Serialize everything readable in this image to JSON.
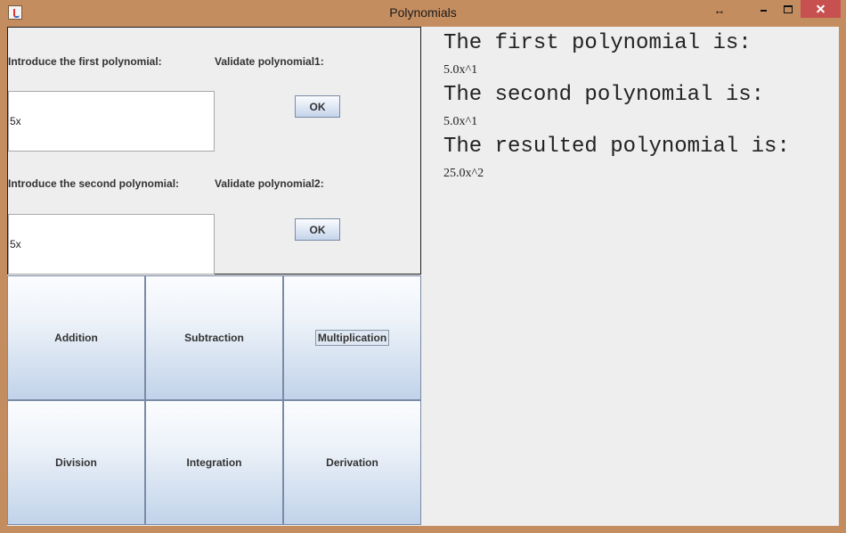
{
  "window": {
    "title": "Polynomials"
  },
  "input_panel": {
    "first_label": "Introduce the first polynomial:",
    "first_value": "5x",
    "validate1_label": "Validate polynomial1:",
    "ok1_label": "OK",
    "second_label": "Introduce the second polynomial:",
    "second_value": "5x",
    "validate2_label": "Validate polynomial2:",
    "ok2_label": "OK"
  },
  "operations": [
    {
      "label": "Addition"
    },
    {
      "label": "Subtraction"
    },
    {
      "label": "Multiplication",
      "focused": true
    },
    {
      "label": "Division"
    },
    {
      "label": "Integration"
    },
    {
      "label": "Derivation"
    }
  ],
  "output": {
    "first_heading": "The first polynomial is:",
    "first_value": "5.0x^1",
    "second_heading": "The second polynomial is:",
    "second_value": "5.0x^1",
    "result_heading": "The resulted polynomial is:",
    "result_value": "25.0x^2"
  },
  "colors": {
    "titlebar": "#c48d60",
    "close_button": "#c75050",
    "panel_background": "#eeeeee"
  }
}
